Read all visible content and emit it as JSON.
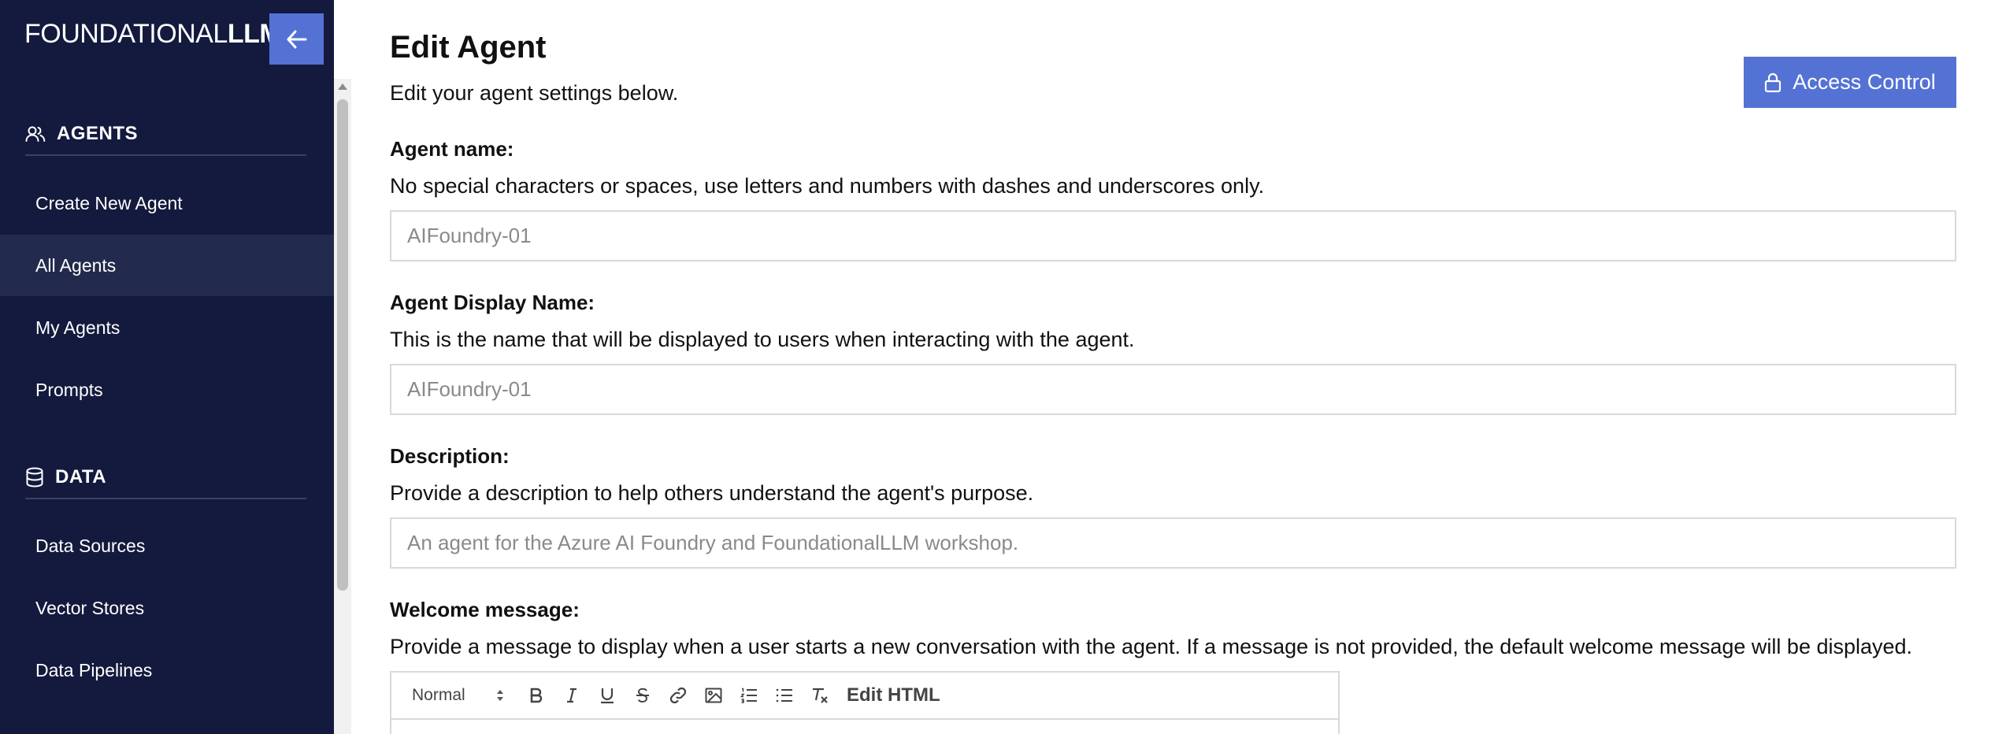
{
  "brand": {
    "logo_thin": "FOUNDATIONAL",
    "logo_bold": "LLM"
  },
  "sidebar": {
    "sections": [
      {
        "title": "AGENTS",
        "icon": "users-icon",
        "items": [
          "Create New Agent",
          "All Agents",
          "My Agents",
          "Prompts"
        ]
      },
      {
        "title": "DATA",
        "icon": "database-icon",
        "items": [
          "Data Sources",
          "Vector Stores",
          "Data Pipelines"
        ]
      }
    ],
    "active_item": "All Agents"
  },
  "page": {
    "title": "Edit Agent",
    "subtitle": "Edit your agent settings below.",
    "access_control_label": "Access Control"
  },
  "fields": {
    "agent_name": {
      "label": "Agent name:",
      "help": "No special characters or spaces, use letters and numbers with dashes and underscores only.",
      "value": "AIFoundry-01"
    },
    "display_name": {
      "label": "Agent Display Name:",
      "help": "This is the name that will be displayed to users when interacting with the agent.",
      "value": "AIFoundry-01"
    },
    "description": {
      "label": "Description:",
      "help": "Provide a description to help others understand the agent's purpose.",
      "value": "An agent for the Azure AI Foundry and FoundationalLLM workshop."
    },
    "welcome_message": {
      "label": "Welcome message:",
      "help": "Provide a message to display when a user starts a new conversation with the agent. If a message is not provided, the default welcome message will be displayed."
    }
  },
  "editor_toolbar": {
    "format_select": "Normal",
    "buttons": [
      "bold-icon",
      "italic-icon",
      "underline-icon",
      "strikethrough-icon",
      "link-icon",
      "image-icon",
      "ordered-list-icon",
      "bullet-list-icon",
      "clear-format-icon"
    ],
    "edit_html_label": "Edit HTML"
  },
  "colors": {
    "sidebar_bg": "#141a3d",
    "accent": "#5472d4",
    "active_item_bg": "#222a4d"
  }
}
